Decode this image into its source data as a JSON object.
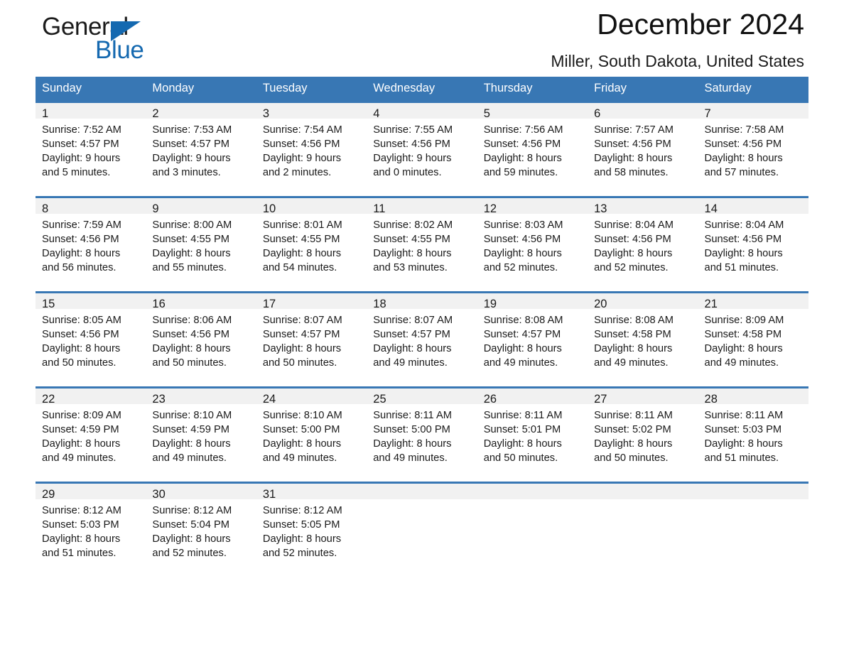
{
  "logo": {
    "word_general": "General",
    "word_blue": "Blue",
    "triangle_color": "#1569b0"
  },
  "header": {
    "title": "December 2024",
    "subtitle": "Miller, South Dakota, United States",
    "accent_color": "#3877b4",
    "daynum_band_color": "#f1f1f1"
  },
  "weekday_headers": [
    "Sunday",
    "Monday",
    "Tuesday",
    "Wednesday",
    "Thursday",
    "Friday",
    "Saturday"
  ],
  "weeks": [
    [
      {
        "day": "1",
        "sunrise": "Sunrise: 7:52 AM",
        "sunset": "Sunset: 4:57 PM",
        "daylight1": "Daylight: 9 hours",
        "daylight2": "and 5 minutes."
      },
      {
        "day": "2",
        "sunrise": "Sunrise: 7:53 AM",
        "sunset": "Sunset: 4:57 PM",
        "daylight1": "Daylight: 9 hours",
        "daylight2": "and 3 minutes."
      },
      {
        "day": "3",
        "sunrise": "Sunrise: 7:54 AM",
        "sunset": "Sunset: 4:56 PM",
        "daylight1": "Daylight: 9 hours",
        "daylight2": "and 2 minutes."
      },
      {
        "day": "4",
        "sunrise": "Sunrise: 7:55 AM",
        "sunset": "Sunset: 4:56 PM",
        "daylight1": "Daylight: 9 hours",
        "daylight2": "and 0 minutes."
      },
      {
        "day": "5",
        "sunrise": "Sunrise: 7:56 AM",
        "sunset": "Sunset: 4:56 PM",
        "daylight1": "Daylight: 8 hours",
        "daylight2": "and 59 minutes."
      },
      {
        "day": "6",
        "sunrise": "Sunrise: 7:57 AM",
        "sunset": "Sunset: 4:56 PM",
        "daylight1": "Daylight: 8 hours",
        "daylight2": "and 58 minutes."
      },
      {
        "day": "7",
        "sunrise": "Sunrise: 7:58 AM",
        "sunset": "Sunset: 4:56 PM",
        "daylight1": "Daylight: 8 hours",
        "daylight2": "and 57 minutes."
      }
    ],
    [
      {
        "day": "8",
        "sunrise": "Sunrise: 7:59 AM",
        "sunset": "Sunset: 4:56 PM",
        "daylight1": "Daylight: 8 hours",
        "daylight2": "and 56 minutes."
      },
      {
        "day": "9",
        "sunrise": "Sunrise: 8:00 AM",
        "sunset": "Sunset: 4:55 PM",
        "daylight1": "Daylight: 8 hours",
        "daylight2": "and 55 minutes."
      },
      {
        "day": "10",
        "sunrise": "Sunrise: 8:01 AM",
        "sunset": "Sunset: 4:55 PM",
        "daylight1": "Daylight: 8 hours",
        "daylight2": "and 54 minutes."
      },
      {
        "day": "11",
        "sunrise": "Sunrise: 8:02 AM",
        "sunset": "Sunset: 4:55 PM",
        "daylight1": "Daylight: 8 hours",
        "daylight2": "and 53 minutes."
      },
      {
        "day": "12",
        "sunrise": "Sunrise: 8:03 AM",
        "sunset": "Sunset: 4:56 PM",
        "daylight1": "Daylight: 8 hours",
        "daylight2": "and 52 minutes."
      },
      {
        "day": "13",
        "sunrise": "Sunrise: 8:04 AM",
        "sunset": "Sunset: 4:56 PM",
        "daylight1": "Daylight: 8 hours",
        "daylight2": "and 52 minutes."
      },
      {
        "day": "14",
        "sunrise": "Sunrise: 8:04 AM",
        "sunset": "Sunset: 4:56 PM",
        "daylight1": "Daylight: 8 hours",
        "daylight2": "and 51 minutes."
      }
    ],
    [
      {
        "day": "15",
        "sunrise": "Sunrise: 8:05 AM",
        "sunset": "Sunset: 4:56 PM",
        "daylight1": "Daylight: 8 hours",
        "daylight2": "and 50 minutes."
      },
      {
        "day": "16",
        "sunrise": "Sunrise: 8:06 AM",
        "sunset": "Sunset: 4:56 PM",
        "daylight1": "Daylight: 8 hours",
        "daylight2": "and 50 minutes."
      },
      {
        "day": "17",
        "sunrise": "Sunrise: 8:07 AM",
        "sunset": "Sunset: 4:57 PM",
        "daylight1": "Daylight: 8 hours",
        "daylight2": "and 50 minutes."
      },
      {
        "day": "18",
        "sunrise": "Sunrise: 8:07 AM",
        "sunset": "Sunset: 4:57 PM",
        "daylight1": "Daylight: 8 hours",
        "daylight2": "and 49 minutes."
      },
      {
        "day": "19",
        "sunrise": "Sunrise: 8:08 AM",
        "sunset": "Sunset: 4:57 PM",
        "daylight1": "Daylight: 8 hours",
        "daylight2": "and 49 minutes."
      },
      {
        "day": "20",
        "sunrise": "Sunrise: 8:08 AM",
        "sunset": "Sunset: 4:58 PM",
        "daylight1": "Daylight: 8 hours",
        "daylight2": "and 49 minutes."
      },
      {
        "day": "21",
        "sunrise": "Sunrise: 8:09 AM",
        "sunset": "Sunset: 4:58 PM",
        "daylight1": "Daylight: 8 hours",
        "daylight2": "and 49 minutes."
      }
    ],
    [
      {
        "day": "22",
        "sunrise": "Sunrise: 8:09 AM",
        "sunset": "Sunset: 4:59 PM",
        "daylight1": "Daylight: 8 hours",
        "daylight2": "and 49 minutes."
      },
      {
        "day": "23",
        "sunrise": "Sunrise: 8:10 AM",
        "sunset": "Sunset: 4:59 PM",
        "daylight1": "Daylight: 8 hours",
        "daylight2": "and 49 minutes."
      },
      {
        "day": "24",
        "sunrise": "Sunrise: 8:10 AM",
        "sunset": "Sunset: 5:00 PM",
        "daylight1": "Daylight: 8 hours",
        "daylight2": "and 49 minutes."
      },
      {
        "day": "25",
        "sunrise": "Sunrise: 8:11 AM",
        "sunset": "Sunset: 5:00 PM",
        "daylight1": "Daylight: 8 hours",
        "daylight2": "and 49 minutes."
      },
      {
        "day": "26",
        "sunrise": "Sunrise: 8:11 AM",
        "sunset": "Sunset: 5:01 PM",
        "daylight1": "Daylight: 8 hours",
        "daylight2": "and 50 minutes."
      },
      {
        "day": "27",
        "sunrise": "Sunrise: 8:11 AM",
        "sunset": "Sunset: 5:02 PM",
        "daylight1": "Daylight: 8 hours",
        "daylight2": "and 50 minutes."
      },
      {
        "day": "28",
        "sunrise": "Sunrise: 8:11 AM",
        "sunset": "Sunset: 5:03 PM",
        "daylight1": "Daylight: 8 hours",
        "daylight2": "and 51 minutes."
      }
    ],
    [
      {
        "day": "29",
        "sunrise": "Sunrise: 8:12 AM",
        "sunset": "Sunset: 5:03 PM",
        "daylight1": "Daylight: 8 hours",
        "daylight2": "and 51 minutes."
      },
      {
        "day": "30",
        "sunrise": "Sunrise: 8:12 AM",
        "sunset": "Sunset: 5:04 PM",
        "daylight1": "Daylight: 8 hours",
        "daylight2": "and 52 minutes."
      },
      {
        "day": "31",
        "sunrise": "Sunrise: 8:12 AM",
        "sunset": "Sunset: 5:05 PM",
        "daylight1": "Daylight: 8 hours",
        "daylight2": "and 52 minutes."
      },
      {
        "day": "",
        "sunrise": "",
        "sunset": "",
        "daylight1": "",
        "daylight2": ""
      },
      {
        "day": "",
        "sunrise": "",
        "sunset": "",
        "daylight1": "",
        "daylight2": ""
      },
      {
        "day": "",
        "sunrise": "",
        "sunset": "",
        "daylight1": "",
        "daylight2": ""
      },
      {
        "day": "",
        "sunrise": "",
        "sunset": "",
        "daylight1": "",
        "daylight2": ""
      }
    ]
  ]
}
